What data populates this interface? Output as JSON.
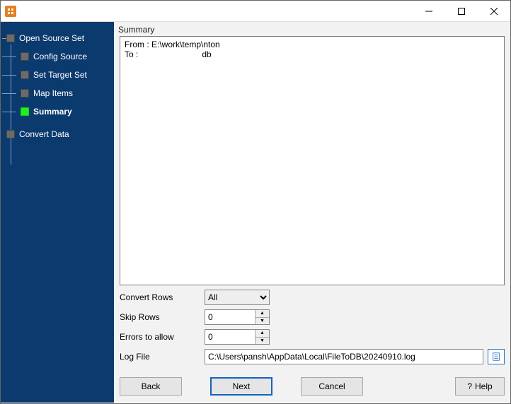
{
  "sidebar": {
    "items": [
      {
        "label": "Open Source Set"
      },
      {
        "label": "Config Source"
      },
      {
        "label": "Set Target Set"
      },
      {
        "label": "Map Items"
      },
      {
        "label": "Summary"
      },
      {
        "label": "Convert Data"
      }
    ]
  },
  "main": {
    "summary_label": "Summary",
    "summary_text": "From : E:\\work\\temp\\nton\nTo :                           db",
    "convert_rows": {
      "label": "Convert Rows",
      "options": [
        "All"
      ],
      "value": "All"
    },
    "skip_rows": {
      "label": "Skip Rows",
      "value": "0"
    },
    "errors_allow": {
      "label": "Errors to allow",
      "value": "0"
    },
    "log_file": {
      "label": "Log File",
      "value": "C:\\Users\\pansh\\AppData\\Local\\FileToDB\\20240910.log"
    }
  },
  "buttons": {
    "back": "Back",
    "next": "Next",
    "cancel": "Cancel",
    "help": "Help"
  }
}
